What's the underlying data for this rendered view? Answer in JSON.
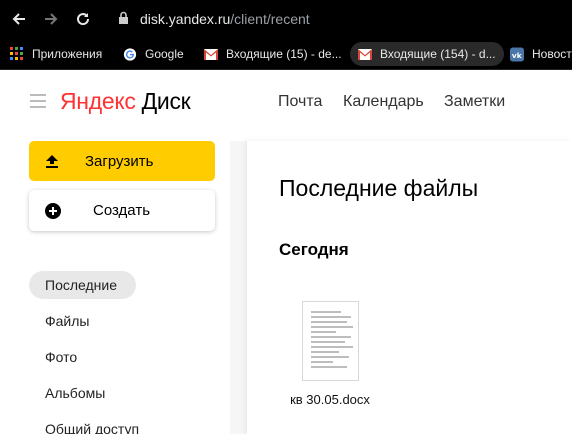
{
  "browser": {
    "url_host": "disk.yandex.ru",
    "url_path": "/client/recent",
    "icons": {
      "back": "arrow-left-icon",
      "forward": "arrow-right-icon",
      "reload": "reload-icon",
      "lock": "lock-icon"
    }
  },
  "bookmarks": [
    {
      "label": "Приложения",
      "icon": "apps-grid-icon"
    },
    {
      "label": "Google",
      "icon": "google-icon"
    },
    {
      "label": "Входящие (15) - de...",
      "icon": "gmail-icon"
    },
    {
      "label": "Входящие (154) - d...",
      "icon": "gmail-icon"
    },
    {
      "label": "Новост",
      "icon": "vk-icon"
    }
  ],
  "header": {
    "logo_ya": "Яндекс",
    "logo_rest": " Диск",
    "nav": [
      "Почта",
      "Календарь",
      "Заметки"
    ]
  },
  "sidebar": {
    "upload_label": "Загрузить",
    "create_label": "Создать",
    "items": [
      {
        "label": "Последние",
        "active": true
      },
      {
        "label": "Файлы"
      },
      {
        "label": "Фото"
      },
      {
        "label": "Альбомы"
      },
      {
        "label": "Общий доступ"
      }
    ]
  },
  "main": {
    "title": "Последние файлы",
    "section": "Сегодня",
    "files": [
      {
        "name": "кв 30.05.docx",
        "icon": "document-thumbnail"
      }
    ]
  },
  "colors": {
    "accent": "#ffcc00",
    "logo_red": "#ff3333",
    "chrome_bg": "#000000"
  }
}
